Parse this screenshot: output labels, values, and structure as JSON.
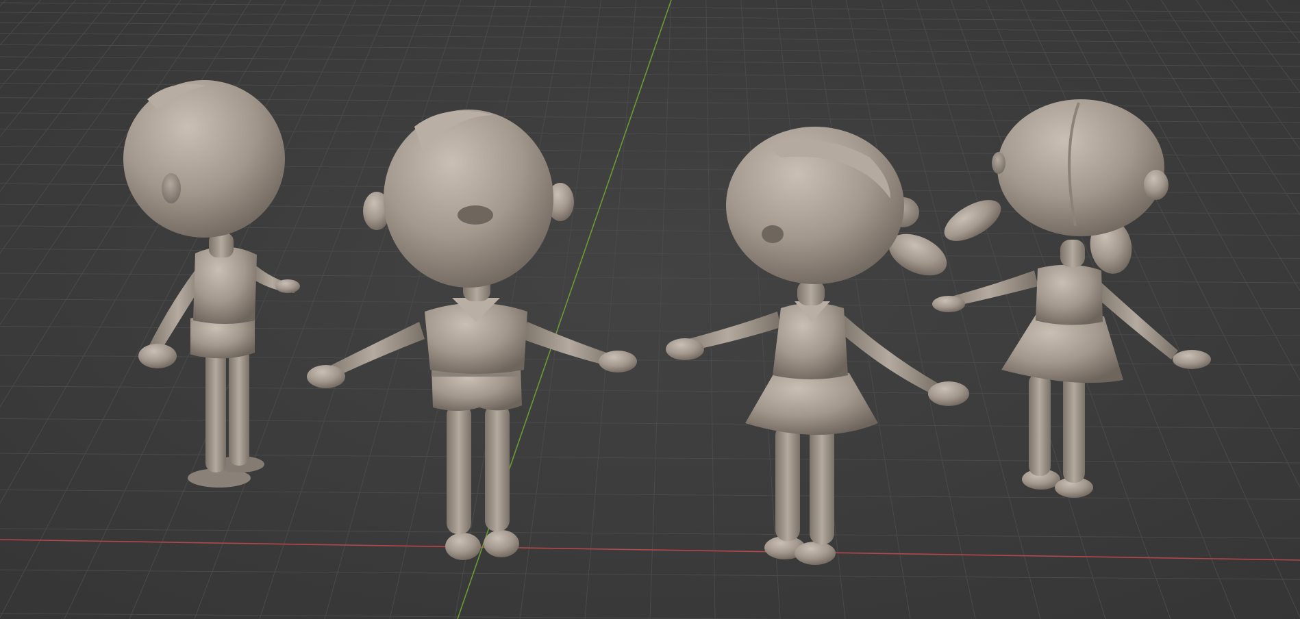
{
  "viewport": {
    "background_color": "#3d3d3d",
    "grid_color": "#4a4a4a",
    "x_axis_color": "#c0484a",
    "y_axis_color": "#6a9a2e",
    "clay_color": "#a0968c"
  },
  "models": [
    {
      "name": "boy-back-view"
    },
    {
      "name": "boy-front-view"
    },
    {
      "name": "girl-front-view"
    },
    {
      "name": "girl-back-view"
    }
  ]
}
